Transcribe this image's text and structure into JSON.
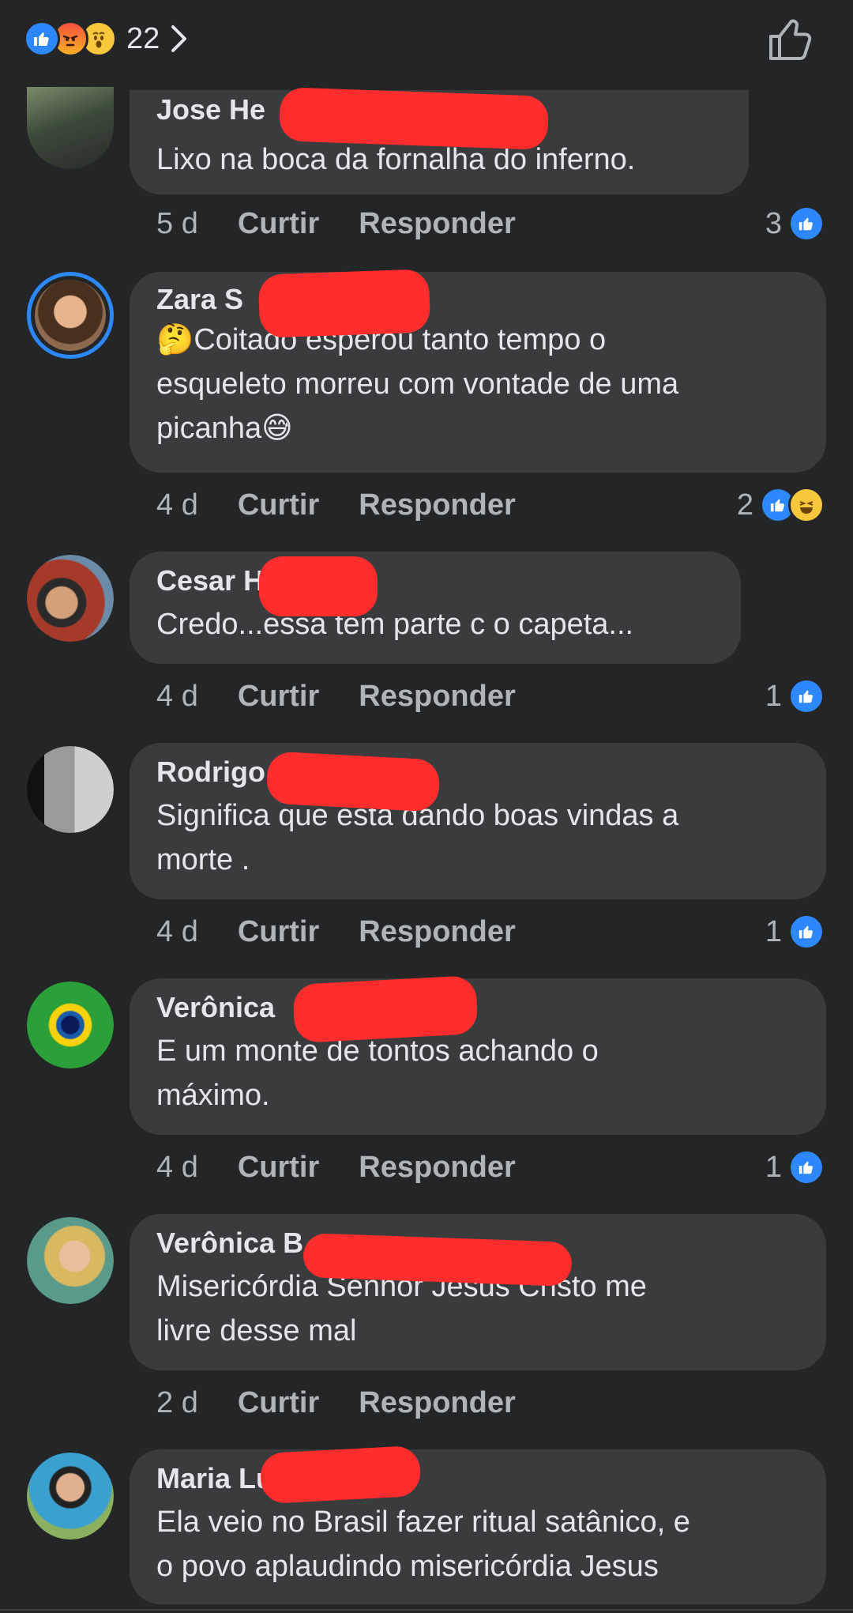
{
  "header": {
    "reaction_count": "22",
    "reactions": [
      "like-icon",
      "angry-icon",
      "wow-icon"
    ]
  },
  "comments": [
    {
      "name": "Jose He",
      "text": [
        "Lixo na boca da fornalha do inferno."
      ],
      "time": "5 d",
      "like": "Curtir",
      "reply": "Responder",
      "reaction_count": "3"
    },
    {
      "name": "Zara S",
      "text": [
        "🤔Coitado esperou tanto tempo o",
        "esqueleto morreu com vontade de uma",
        "picanha😅"
      ],
      "time": "4 d",
      "like": "Curtir",
      "reply": "Responder",
      "reaction_count": "2"
    },
    {
      "name": "Cesar H",
      "text": [
        "Credo...essa tem parte c o capeta..."
      ],
      "time": "4 d",
      "like": "Curtir",
      "reply": "Responder",
      "reaction_count": "1"
    },
    {
      "name": "Rodrigo",
      "text": [
        "Significa que esta dando boas vindas a",
        "morte ."
      ],
      "time": "4 d",
      "like": "Curtir",
      "reply": "Responder",
      "reaction_count": "1"
    },
    {
      "name": "Verônica",
      "text": [
        "E um monte de tontos achando o",
        "máximo."
      ],
      "time": "4 d",
      "like": "Curtir",
      "reply": "Responder",
      "reaction_count": "1"
    },
    {
      "name": "Verônica B",
      "text": [
        "Misericórdia Senhor Jesus Cristo  me",
        "livre desse mal"
      ],
      "time": "2 d",
      "like": "Curtir",
      "reply": "Responder",
      "reaction_count": ""
    },
    {
      "name": "Maria Lu",
      "text": [
        "Ela veio no Brasil fazer ritual satânico, e",
        "o povo aplaudindo misericórdia Jesus"
      ],
      "time": "",
      "like": "",
      "reply": "",
      "reaction_count": ""
    }
  ],
  "colors": {
    "background": "#242526",
    "bubble": "#3a3b3c",
    "accent": "#2d88ff",
    "redaction": "#ff2d2d"
  }
}
